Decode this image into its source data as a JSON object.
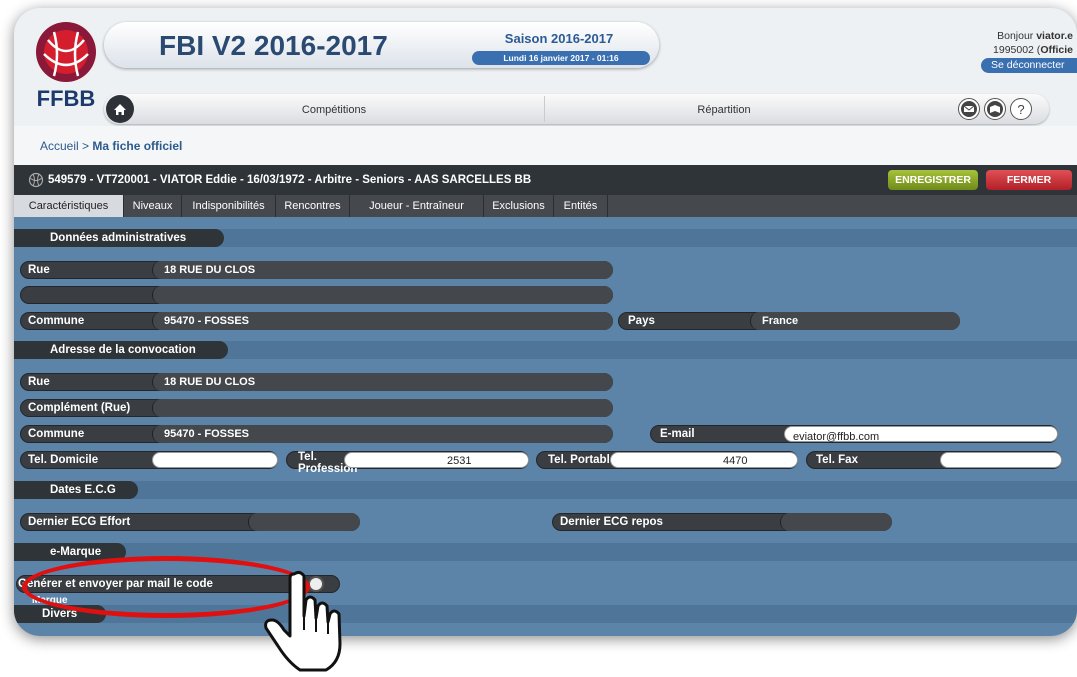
{
  "header": {
    "logo_text": "FFBB",
    "app_title": "FBI V2 2016-2017",
    "season": "Saison 2016-2017",
    "date": "Lundi 16 janvier 2017 - 01:16",
    "greeting_prefix": "Bonjour ",
    "greeting_user": "viator.e",
    "user_id_prefix": "1995002 (",
    "user_role": "Officie",
    "logout_label": "Se déconnecter"
  },
  "nav": {
    "items": [
      "Compétitions",
      "Répartition"
    ],
    "icons": [
      "home-icon",
      "mail-icon",
      "book-icon",
      "help-icon"
    ],
    "help_glyph": "?"
  },
  "breadcrumb": {
    "home": "Accueil",
    "separator": " > ",
    "current": "Ma fiche officiel"
  },
  "record": {
    "title": "549579 - VT720001 - VIATOR Eddie - 16/03/1972 - Arbitre - Seniors - AAS SARCELLES BB",
    "save_label": "ENREGISTRER",
    "close_label": "FERMER"
  },
  "tabs": [
    "Caractéristiques",
    "Niveaux",
    "Indisponibilités",
    "Rencontres",
    "Joueur - Entraîneur",
    "Exclusions",
    "Entités"
  ],
  "admin": {
    "section": "Données administratives",
    "rue_label": "Rue",
    "rue_value": "18 RUE DU CLOS",
    "rue2_value": "",
    "commune_label": "Commune",
    "commune_value": "95470 - FOSSES",
    "pays_label": "Pays",
    "pays_value": "France"
  },
  "convocation": {
    "section": "Adresse de la convocation",
    "rue_label": "Rue",
    "rue_value": "18 RUE DU CLOS",
    "complement_label": "Complément (Rue)",
    "complement_value": "",
    "commune_label": "Commune",
    "commune_value": "95470 - FOSSES",
    "email_label": "E-mail",
    "email_value": "eviator@ffbb.com",
    "tel_dom_label": "Tel. Domicile",
    "tel_dom_value": "",
    "tel_pro_label": "Tel. Professionnel",
    "tel_pro_value": "2531",
    "tel_port_label": "Tel. Portabl",
    "tel_port_value": "4470",
    "tel_fax_label": "Tel. Fax",
    "tel_fax_value": ""
  },
  "ecg": {
    "section": "Dates E.C.G",
    "effort_label": "Dernier ECG Effort",
    "effort_value": "",
    "repos_label": "Dernier ECG repos",
    "repos_value": ""
  },
  "emarque": {
    "section": "e-Marque",
    "generate_label": "Générer et envoyer par mail le code",
    "code_label": "Marque"
  },
  "divers": {
    "section": "Divers"
  }
}
